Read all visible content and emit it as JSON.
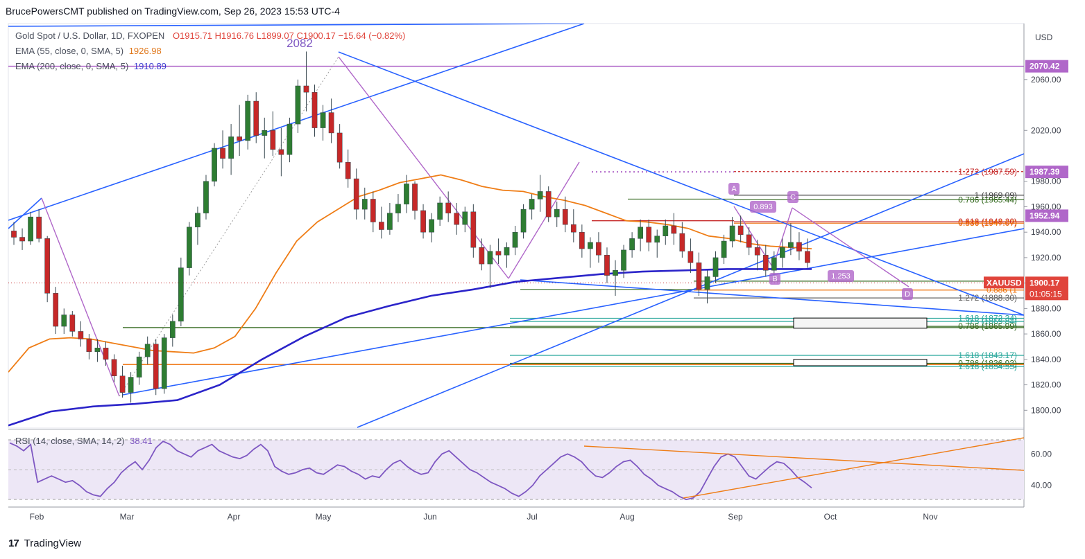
{
  "header": {
    "publisher": "BrucePowersCMT published on TradingView.com, Sep 26, 2023 15:53 UTC-4"
  },
  "legend": {
    "symbol": "Gold Spot / U.S. Dollar, 1D, FXOPEN",
    "ohlc": "O1915.71  H1916.76  L1899.07  C1900.17  −15.64 (−0.82%)",
    "ema55_label": "EMA (55, close, 0, SMA, 5)",
    "ema55_value": "1926.98",
    "ema200_label": "EMA (200, close, 0, SMA, 5)",
    "ema200_value": "1910.89"
  },
  "rsi_legend": {
    "label": "RSI (14, close, SMA, 14, 2)",
    "value": "38.41"
  },
  "currency": "USD",
  "brand": "TradingView",
  "colors": {
    "up": "#26a69a",
    "up_body": "#2e7d32",
    "down": "#c62828",
    "ema55": "#ef7d16",
    "ema200": "#2b24c9",
    "trendline": "#2962ff",
    "purple": "#b067c9",
    "rsi": "#7e57c2",
    "rsi_band": "#ede7f6"
  },
  "chart_data": [
    {
      "type": "candlestick",
      "title": "Gold Spot / U.S. Dollar, 1D, FXOPEN",
      "ylim": [
        1786,
        2104
      ],
      "y_ticks": [
        1800,
        1820,
        1840,
        1860,
        1880,
        1900,
        1920,
        1940,
        1960,
        1980,
        2020,
        2060
      ],
      "x_ticks": [
        "Feb",
        "Mar",
        "Apr",
        "May",
        "Jun",
        "Jul",
        "Aug",
        "Sep",
        "Oct",
        "Nov"
      ],
      "price_tags": [
        {
          "value": "2070.42",
          "color": "#b067c9"
        },
        {
          "value": "1987.39",
          "color": "#b067c9"
        },
        {
          "value": "1952.94",
          "color": "#b067c9"
        },
        {
          "value": "1900.17",
          "color": "#e0443b",
          "extra": "01:05:15",
          "name": "XAUUSD"
        }
      ],
      "annotations": [
        {
          "text": "2082"
        },
        {
          "text": "A"
        },
        {
          "text": "B"
        },
        {
          "text": "C"
        },
        {
          "text": "D"
        },
        {
          "text": "0.893"
        },
        {
          "text": "1.253"
        }
      ],
      "fib_levels": [
        {
          "label": "1.272 (1987.59)",
          "price": 1987.59,
          "color": "#c62828"
        },
        {
          "label": "1 (1969.09)",
          "price": 1969.09,
          "color": "#424242"
        },
        {
          "label": "0.786 (1965.44)",
          "price": 1965.44,
          "color": "#33691e"
        },
        {
          "label": "0.618 (1948.20)",
          "price": 1948.2,
          "color": "#c62828"
        },
        {
          "label": "0.886 (1947.07)",
          "price": 1947.07,
          "color": "#ef6c00"
        },
        {
          "label": "0.786 (1",
          "price": 1901.5,
          "color": "#33691e"
        },
        {
          "label": "0.886 (1",
          "price": 1894.5,
          "color": "#ef6c00"
        },
        {
          "label": "1.272 (1888.30)",
          "price": 1888.3,
          "color": "#616161"
        },
        {
          "label": "1.618 (1872.34)",
          "price": 1872.34,
          "color": "#26a69a"
        },
        {
          "label": "0.5 (1869.84)",
          "price": 1869.84,
          "color": "#26a69a"
        },
        {
          "label": "0.786 (1865.99)",
          "price": 1865.99,
          "color": "#33691e"
        },
        {
          "label": "1.618 (1843.17)",
          "price": 1843.17,
          "color": "#26a69a"
        },
        {
          "label": "0.786 (1836.93)",
          "price": 1836.93,
          "color": "#33691e"
        },
        {
          "label": "1.618 (1834.55)",
          "price": 1834.55,
          "color": "#26a69a"
        }
      ],
      "ema55": [
        1830,
        1849,
        1856,
        1857,
        1856,
        1853,
        1850,
        1847,
        1846,
        1845,
        1849,
        1858,
        1880,
        1908,
        1933,
        1948,
        1958,
        1968,
        1973,
        1979,
        1982,
        1985,
        1981,
        1976,
        1973,
        1972,
        1968,
        1965,
        1961,
        1955,
        1949,
        1948,
        1946,
        1943,
        1937,
        1935,
        1931,
        1929,
        1928,
        1927
      ],
      "ema200": [
        1788,
        1799,
        1803,
        1805,
        1808,
        1820,
        1840,
        1858,
        1873,
        1882,
        1890,
        1895,
        1901,
        1904,
        1907,
        1909,
        1910,
        1911,
        1911,
        1911
      ],
      "candles": [
        [
          1941,
          1948,
          1930,
          1936
        ],
        [
          1936,
          1943,
          1926,
          1933
        ],
        [
          1933,
          1956,
          1930,
          1952
        ],
        [
          1952,
          1958,
          1932,
          1935
        ],
        [
          1935,
          1937,
          1885,
          1892
        ],
        [
          1892,
          1897,
          1860,
          1866
        ],
        [
          1866,
          1880,
          1860,
          1875
        ],
        [
          1875,
          1878,
          1858,
          1862
        ],
        [
          1862,
          1870,
          1850,
          1856
        ],
        [
          1856,
          1860,
          1840,
          1846
        ],
        [
          1846,
          1856,
          1838,
          1849
        ],
        [
          1849,
          1854,
          1835,
          1840
        ],
        [
          1840,
          1844,
          1822,
          1827
        ],
        [
          1827,
          1835,
          1810,
          1814
        ],
        [
          1814,
          1830,
          1806,
          1826
        ],
        [
          1826,
          1846,
          1820,
          1842
        ],
        [
          1842,
          1858,
          1836,
          1852
        ],
        [
          1852,
          1856,
          1812,
          1817
        ],
        [
          1817,
          1860,
          1813,
          1857
        ],
        [
          1857,
          1875,
          1850,
          1870
        ],
        [
          1870,
          1920,
          1866,
          1912
        ],
        [
          1912,
          1948,
          1906,
          1944
        ],
        [
          1944,
          1960,
          1930,
          1955
        ],
        [
          1955,
          1985,
          1950,
          1980
        ],
        [
          1980,
          2010,
          1976,
          2006
        ],
        [
          2006,
          2020,
          1990,
          1998
        ],
        [
          1998,
          2025,
          1985,
          2015
        ],
        [
          2015,
          2040,
          2000,
          2012
        ],
        [
          2012,
          2048,
          2005,
          2043
        ],
        [
          2043,
          2050,
          2010,
          2016
        ],
        [
          2016,
          2030,
          1998,
          2020
        ],
        [
          2020,
          2035,
          2000,
          2005
        ],
        [
          2005,
          2022,
          1984,
          2001
        ],
        [
          2001,
          2030,
          1995,
          2025
        ],
        [
          2025,
          2060,
          2018,
          2055
        ],
        [
          2055,
          2082,
          2035,
          2050
        ],
        [
          2050,
          2056,
          2015,
          2022
        ],
        [
          2022,
          2040,
          2012,
          2034
        ],
        [
          2034,
          2045,
          2010,
          2018
        ],
        [
          2018,
          2025,
          1990,
          1995
        ],
        [
          1995,
          2005,
          1975,
          1982
        ],
        [
          1982,
          1990,
          1950,
          1958
        ],
        [
          1958,
          1975,
          1950,
          1966
        ],
        [
          1966,
          1972,
          1940,
          1948
        ],
        [
          1948,
          1960,
          1935,
          1942
        ],
        [
          1942,
          1963,
          1938,
          1955
        ],
        [
          1955,
          1970,
          1948,
          1962
        ],
        [
          1962,
          1985,
          1955,
          1978
        ],
        [
          1978,
          1980,
          1950,
          1957
        ],
        [
          1957,
          1962,
          1935,
          1940
        ],
        [
          1940,
          1955,
          1932,
          1950
        ],
        [
          1950,
          1968,
          1945,
          1963
        ],
        [
          1963,
          1972,
          1948,
          1955
        ],
        [
          1955,
          1963,
          1938,
          1946
        ],
        [
          1946,
          1960,
          1940,
          1956
        ],
        [
          1956,
          1962,
          1920,
          1928
        ],
        [
          1928,
          1935,
          1910,
          1915
        ],
        [
          1915,
          1930,
          1896,
          1925
        ],
        [
          1925,
          1935,
          1915,
          1922
        ],
        [
          1922,
          1932,
          1912,
          1928
        ],
        [
          1928,
          1945,
          1922,
          1940
        ],
        [
          1940,
          1962,
          1935,
          1958
        ],
        [
          1958,
          1970,
          1950,
          1966
        ],
        [
          1966,
          1985,
          1956,
          1972
        ],
        [
          1972,
          1976,
          1948,
          1952
        ],
        [
          1952,
          1964,
          1944,
          1958
        ],
        [
          1958,
          1968,
          1940,
          1946
        ],
        [
          1946,
          1958,
          1932,
          1940
        ],
        [
          1940,
          1946,
          1920,
          1927
        ],
        [
          1927,
          1936,
          1912,
          1932
        ],
        [
          1932,
          1940,
          1916,
          1922
        ],
        [
          1922,
          1928,
          1900,
          1906
        ],
        [
          1906,
          1918,
          1890,
          1910
        ],
        [
          1910,
          1930,
          1904,
          1926
        ],
        [
          1926,
          1940,
          1920,
          1935
        ],
        [
          1935,
          1950,
          1925,
          1944
        ],
        [
          1944,
          1950,
          1925,
          1932
        ],
        [
          1932,
          1942,
          1920,
          1937
        ],
        [
          1937,
          1950,
          1930,
          1945
        ],
        [
          1945,
          1955,
          1930,
          1939
        ],
        [
          1939,
          1948,
          1920,
          1925
        ],
        [
          1925,
          1935,
          1908,
          1916
        ],
        [
          1916,
          1924,
          1890,
          1895
        ],
        [
          1895,
          1910,
          1884,
          1905
        ],
        [
          1905,
          1925,
          1900,
          1920
        ],
        [
          1920,
          1938,
          1915,
          1933
        ],
        [
          1933,
          1952,
          1928,
          1945
        ],
        [
          1945,
          1953,
          1932,
          1938
        ],
        [
          1938,
          1944,
          1922,
          1928
        ],
        [
          1928,
          1934,
          1910,
          1922
        ],
        [
          1922,
          1930,
          1905,
          1910
        ],
        [
          1910,
          1925,
          1904,
          1920
        ],
        [
          1920,
          1935,
          1912,
          1928
        ],
        [
          1928,
          1947,
          1922,
          1932
        ],
        [
          1932,
          1940,
          1918,
          1925
        ],
        [
          1925,
          1935,
          1912,
          1916
        ]
      ]
    },
    {
      "type": "line",
      "title": "RSI (14, close, SMA, 14, 2)",
      "ylim": [
        28,
        72
      ],
      "y_ticks": [
        40,
        60
      ],
      "values": [
        67,
        65,
        62,
        66,
        42,
        44,
        46,
        44,
        42,
        43,
        40,
        36,
        34,
        33,
        38,
        42,
        48,
        52,
        55,
        50,
        56,
        64,
        68,
        66,
        62,
        60,
        58,
        62,
        64,
        66,
        62,
        60,
        58,
        57,
        59,
        63,
        66,
        62,
        52,
        49,
        47,
        48,
        50,
        51,
        48,
        47,
        50,
        53,
        52,
        49,
        47,
        44,
        46,
        45,
        50,
        54,
        56,
        52,
        49,
        47,
        48,
        55,
        60,
        62,
        58,
        54,
        50,
        48,
        45,
        42,
        40,
        38,
        35,
        33,
        36,
        40,
        46,
        50,
        54,
        58,
        60,
        58,
        55,
        50,
        46,
        45,
        48,
        52,
        55,
        56,
        52,
        47,
        44,
        40,
        38,
        36,
        33,
        31,
        32,
        36,
        44,
        52,
        58,
        60,
        58,
        52,
        46,
        44,
        48,
        52,
        55,
        54,
        50,
        45,
        42,
        38.41
      ]
    }
  ]
}
